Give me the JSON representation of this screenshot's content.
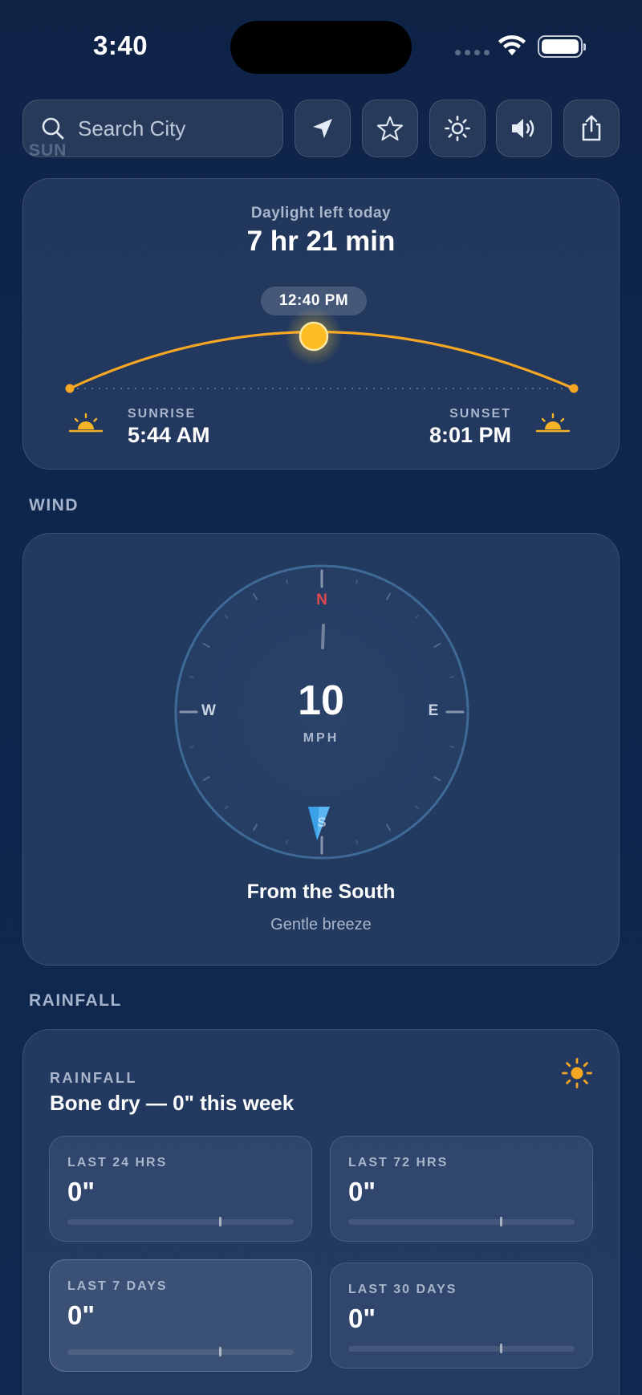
{
  "status_bar": {
    "time": "3:40"
  },
  "toolbar": {
    "search_placeholder": "Search City",
    "buttons": [
      "location-arrow-icon",
      "star-icon",
      "brightness-icon",
      "speaker-icon",
      "share-icon"
    ]
  },
  "sun": {
    "section_title": "SUN",
    "daylight_label": "Daylight left today",
    "daylight_value": "7 hr 21 min",
    "current_time": "12:40 PM",
    "sunrise_label": "SUNRISE",
    "sunrise_time": "5:44 AM",
    "sunset_label": "SUNSET",
    "sunset_time": "8:01 PM",
    "accent": "#f5a623"
  },
  "wind": {
    "section_title": "WIND",
    "speed": "10",
    "unit": "MPH",
    "cardinals": {
      "n": "N",
      "e": "E",
      "s": "S",
      "w": "W"
    },
    "from": "From the South",
    "description": "Gentle breeze",
    "north_color": "#e5484d",
    "arrow_color": "#3aa0e8"
  },
  "rainfall": {
    "section_title": "RAINFALL",
    "kicker": "RAINFALL",
    "headline": "Bone dry — 0\" this week",
    "tiles": [
      {
        "label": "LAST 24 HRS",
        "value": "0\""
      },
      {
        "label": "LAST 72 HRS",
        "value": "0\""
      },
      {
        "label": "LAST 7 DAYS",
        "value": "0\""
      },
      {
        "label": "LAST 30 DAYS",
        "value": "0\""
      }
    ]
  }
}
